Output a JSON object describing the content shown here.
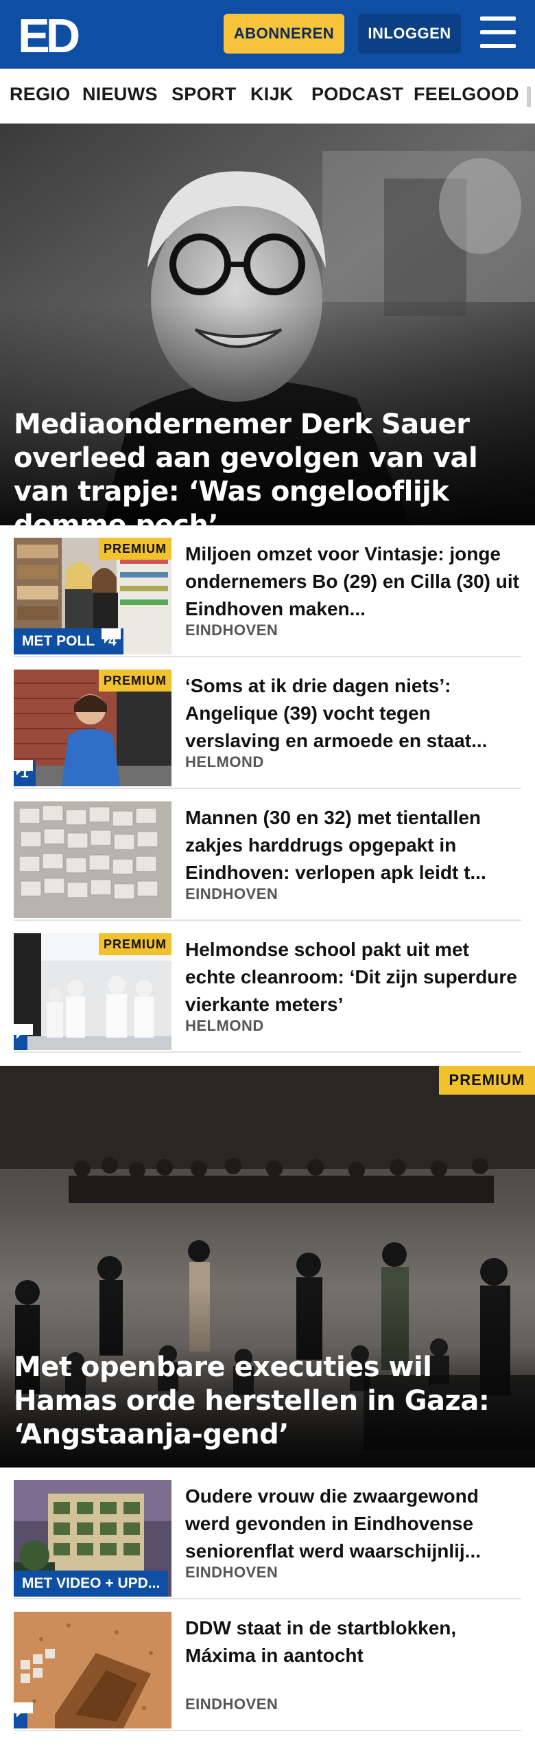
{
  "header": {
    "logo_text": "ED",
    "subscribe_label": "ABONNEREN",
    "login_label": "INLOGGEN",
    "colors": {
      "brand": "#0f4fa3",
      "accent": "#f7c33a",
      "login_bg": "#0b3f86"
    }
  },
  "nav": {
    "items": [
      {
        "label": "REGIO"
      },
      {
        "label": "NIEUWS"
      },
      {
        "label": "SPORT"
      },
      {
        "label": "KIJK"
      },
      {
        "label": "PODCAST"
      },
      {
        "label": "FEELGOOD"
      }
    ]
  },
  "hero": {
    "title": "Mediaondernemer Derk Sauer overleed aan gevolgen van val van trapje: ‘Was ongelooflijk domme pech’"
  },
  "articles_1": [
    {
      "title": "Miljoen omzet voor Vintasje: jonge ondernemers Bo (29) en Cilla (30) uit Eindhoven maken...",
      "location": "EINDHOVEN",
      "premium": "PREMIUM",
      "badge": "MET POLL",
      "comments": "4",
      "thumb": "shop-women"
    },
    {
      "title": "‘Soms at ik drie dagen niets’: Angelique (39) vocht tegen verslaving en armoede en staat...",
      "location": "HELMOND",
      "premium": "PREMIUM",
      "badge": "",
      "comments": "1",
      "thumb": "woman-brick-wall"
    },
    {
      "title": "Mannen (30 en 32) met tientallen zakjes harddrugs opgepakt in Eindhoven: verlopen apk leidt t...",
      "location": "EINDHOVEN",
      "premium": "",
      "badge": "",
      "comments": "",
      "thumb": "drug-bags"
    },
    {
      "title": "Helmondse school pakt uit met echte cleanroom: ‘Dit zijn superdure vierkante meters’",
      "location": "HELMOND",
      "premium": "PREMIUM",
      "badge": "",
      "comments": "",
      "thumb": "cleanroom"
    }
  ],
  "hero2": {
    "title": "Met openbare executies wil Hamas orde herstellen in Gaza: ‘Angstaanja-gend’",
    "premium": "PREMIUM"
  },
  "articles_2": [
    {
      "title": "Oudere vrouw die zwaargewond werd gevonden in Eindhovense seniorenflat werd waarschijnlij...",
      "location": "EINDHOVEN",
      "premium": "",
      "badge": "MET VIDEO + UPD...",
      "comments": "",
      "thumb": "senior-flat"
    },
    {
      "title": "DDW staat in de startblokken, Máxima in aantocht",
      "location": "EINDHOVEN",
      "premium": "",
      "badge": "",
      "comments": "",
      "thumb": "design-installation"
    }
  ]
}
